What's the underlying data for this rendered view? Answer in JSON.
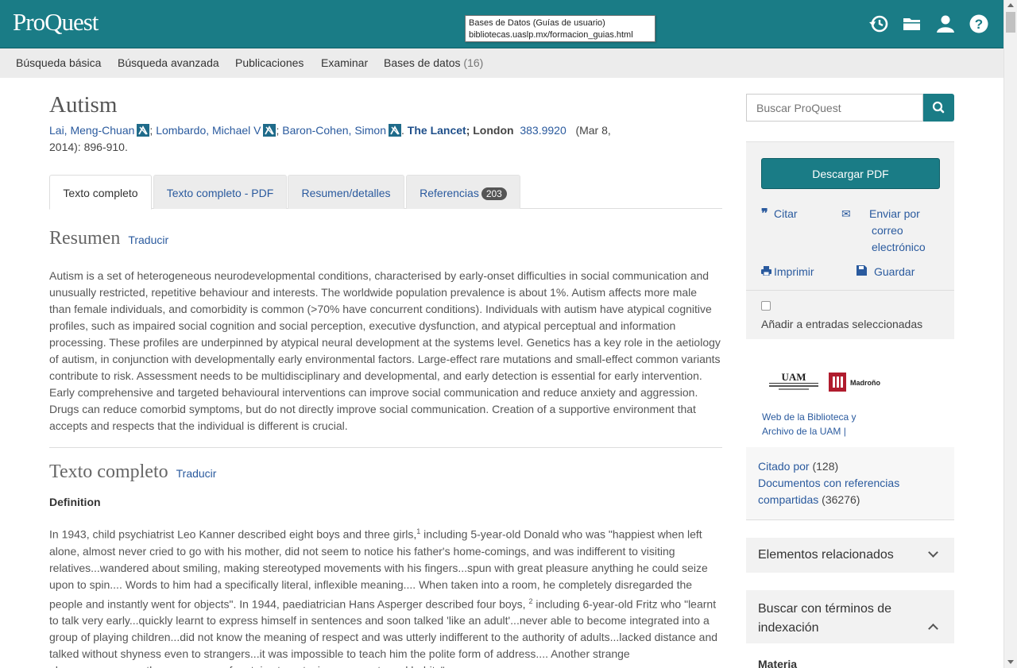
{
  "header": {
    "logo": "ProQuest",
    "tooltip_line1": "Bases de Datos (Guías de usuario)",
    "tooltip_line2": "bibliotecas.uaslp.mx/formacion_guias.html",
    "icons": [
      "history-icon",
      "folder-icon",
      "user-icon",
      "help-icon"
    ]
  },
  "nav": {
    "basic": "Búsqueda básica",
    "advanced": "Búsqueda avanzada",
    "publications": "Publicaciones",
    "browse": "Examinar",
    "databases": "Bases de datos",
    "databases_count": "(16)"
  },
  "article": {
    "title": "Autism",
    "author1": "Lai, Meng-Chuan",
    "author2": "Lombardo, Michael V",
    "author3": "Baron-Cohen, Simon",
    "journal": "The Lancet",
    "place": "; London",
    "volume": "383.9920",
    "date": "(Mar 8,",
    "date2": "2014): 896-910."
  },
  "tabs": {
    "fulltext": "Texto completo",
    "pdf": "Texto completo - PDF",
    "abstract": "Resumen/detalles",
    "references": "Referencias",
    "references_count": "203"
  },
  "abstract": {
    "heading": "Resumen",
    "translate": "Traducir",
    "text": "Autism is a set of heterogeneous neurodevelopmental conditions, characterised by early-onset difficulties in social communication and unusually restricted, repetitive behaviour and interests. The worldwide population prevalence is about 1%. Autism affects more male than female individuals, and comorbidity is common (>70% have concurrent conditions). Individuals with autism have atypical cognitive profiles, such as impaired social cognition and social perception, executive dysfunction, and atypical perceptual and information processing. These profiles are underpinned by atypical neural development at the systems level. Genetics has a key role in the aetiology of autism, in conjunction with developmentally early environmental factors. Large-effect rare mutations and small-effect common variants contribute to risk. Assessment needs to be multidisciplinary and developmental, and early detection is essential for early intervention. Early comprehensive and targeted behavioural interventions can improve social communication and reduce anxiety and aggression. Drugs can reduce comorbid symptoms, but do not directly improve social communication. Creation of a supportive environment that accepts and respects that the individual is different is crucial."
  },
  "fulltext": {
    "heading": "Texto completo",
    "translate": "Traducir",
    "definition_label": "Definition",
    "p1_a": "In 1943, child psychiatrist Leo Kanner described eight boys and three girls,",
    "p1_sup1": "1",
    "p1_b": " including 5-year-old Donald who was \"happiest when left alone, almost never cried to go with his mother, did not seem to notice his father's home-comings, and was indifferent to visiting relatives...wandered about smiling, making stereotyped movements with his fingers...spun with great pleasure anything he could seize upon to spin.... Words to him had a specifically literal, inflexible meaning.... When taken into a room, he completely disregarded the people and instantly went for objects\". In 1944, paediatrician Hans Asperger described four boys, ",
    "p1_sup2": "2",
    "p1_c": " including 6-year-old Fritz who \"learnt to talk very early...quickly learnt to express himself in sentences and soon talked 'like an adult'...never able to become integrated into a group of playing children...did not know the meaning of respect and was utterly indifferent to the authority of adults...lacked distance and talked without shyness even to strangers...it was impossible to teach him the polite form of address.... Another strange phenomenon...was the occurrence of certain stereotypic movements and habits\"."
  },
  "sidebar": {
    "search_placeholder": "Buscar ProQuest",
    "download_pdf": "Descargar PDF",
    "cite": "Citar",
    "email": "Enviar por correo electrónico",
    "print": "Imprimir",
    "save": "Guardar",
    "add_selected": "Añadir a entradas seleccionadas",
    "uam_logo_text": "UAM",
    "madrono_text": "Madroño",
    "library_link": "Web de la Biblioteca y Archivo de la UAM |",
    "cited_by": "Citado por",
    "cited_by_count": "(128)",
    "shared_refs": "Documentos con referencias compartidas",
    "shared_refs_count": "(36276)",
    "related": "Elementos relacionados",
    "index_search": "Buscar con términos de indexación",
    "materia": "Materia"
  },
  "colors": {
    "header_teal": "#1a7c86",
    "link_blue": "#2a5a9e"
  }
}
